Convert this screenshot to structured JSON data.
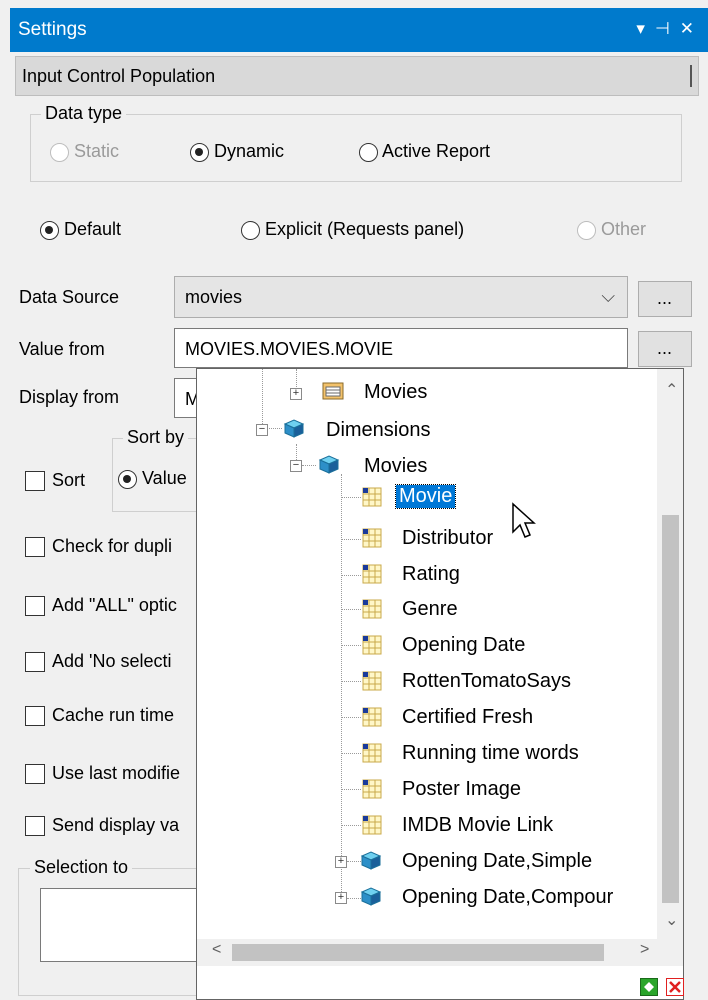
{
  "window": {
    "title": "Settings",
    "icons": [
      "dropdown-arrow-icon",
      "pin-icon",
      "close-icon"
    ]
  },
  "section": {
    "title": "Input Control Population"
  },
  "data_type": {
    "legend": "Data type",
    "options": [
      {
        "label": "Static",
        "selected": false,
        "disabled": true
      },
      {
        "label": "Dynamic",
        "selected": true,
        "disabled": false
      },
      {
        "label": "Active Report",
        "selected": false,
        "disabled": false
      }
    ]
  },
  "mode": {
    "options": [
      {
        "label": "Default",
        "selected": true,
        "disabled": false
      },
      {
        "label": "Explicit (Requests panel)",
        "selected": false,
        "disabled": false
      },
      {
        "label": "Other",
        "selected": false,
        "disabled": true
      }
    ]
  },
  "form": {
    "data_source_label": "Data Source",
    "data_source_value": "movies",
    "value_from_label": "Value from",
    "value_from_value": "MOVIES.MOVIES.MOVIE",
    "display_from_label": "Display from",
    "display_from_value": "M",
    "browse_label": "..."
  },
  "sort": {
    "legend": "Sort by",
    "checkbox_label": "Sort",
    "radio_label": "Value"
  },
  "checkboxes": [
    "Check for dupli",
    "Add \"ALL\" optic",
    "Add 'No selecti",
    "Cache run time",
    "Use last modifie",
    "Send display va"
  ],
  "selection": {
    "legend": "Selection to"
  },
  "tree": {
    "items": [
      {
        "label": "Movies",
        "level": 2,
        "icon": "folder-table-icon",
        "expander": "+"
      },
      {
        "label": "Dimensions",
        "level": 1,
        "icon": "cube-icon",
        "expander": "-"
      },
      {
        "label": "Movies",
        "level": 2,
        "icon": "cube-icon",
        "expander": "-"
      },
      {
        "label": "Movie",
        "level": 3,
        "icon": "field-grid-icon",
        "selected": true
      },
      {
        "label": "Distributor",
        "level": 3,
        "icon": "field-grid-icon"
      },
      {
        "label": "Rating",
        "level": 3,
        "icon": "field-grid-icon"
      },
      {
        "label": "Genre",
        "level": 3,
        "icon": "field-grid-icon"
      },
      {
        "label": "Opening Date",
        "level": 3,
        "icon": "field-grid-icon"
      },
      {
        "label": "RottenTomatoSays",
        "level": 3,
        "icon": "field-grid-icon"
      },
      {
        "label": "Certified Fresh",
        "level": 3,
        "icon": "field-grid-icon"
      },
      {
        "label": "Running time words",
        "level": 3,
        "icon": "field-grid-icon"
      },
      {
        "label": "Poster Image",
        "level": 3,
        "icon": "field-grid-icon"
      },
      {
        "label": "IMDB Movie Link",
        "level": 3,
        "icon": "field-grid-icon"
      },
      {
        "label": "Opening Date,Simple",
        "level": 3,
        "icon": "cube-icon",
        "expander": "+"
      },
      {
        "label": "Opening Date,Compour",
        "level": 3,
        "icon": "cube-icon",
        "expander": "+"
      }
    ]
  },
  "colors": {
    "accent": "#007acc",
    "selection": "#0078d7",
    "ok": "#2aa52a",
    "cancel": "#e02020"
  }
}
